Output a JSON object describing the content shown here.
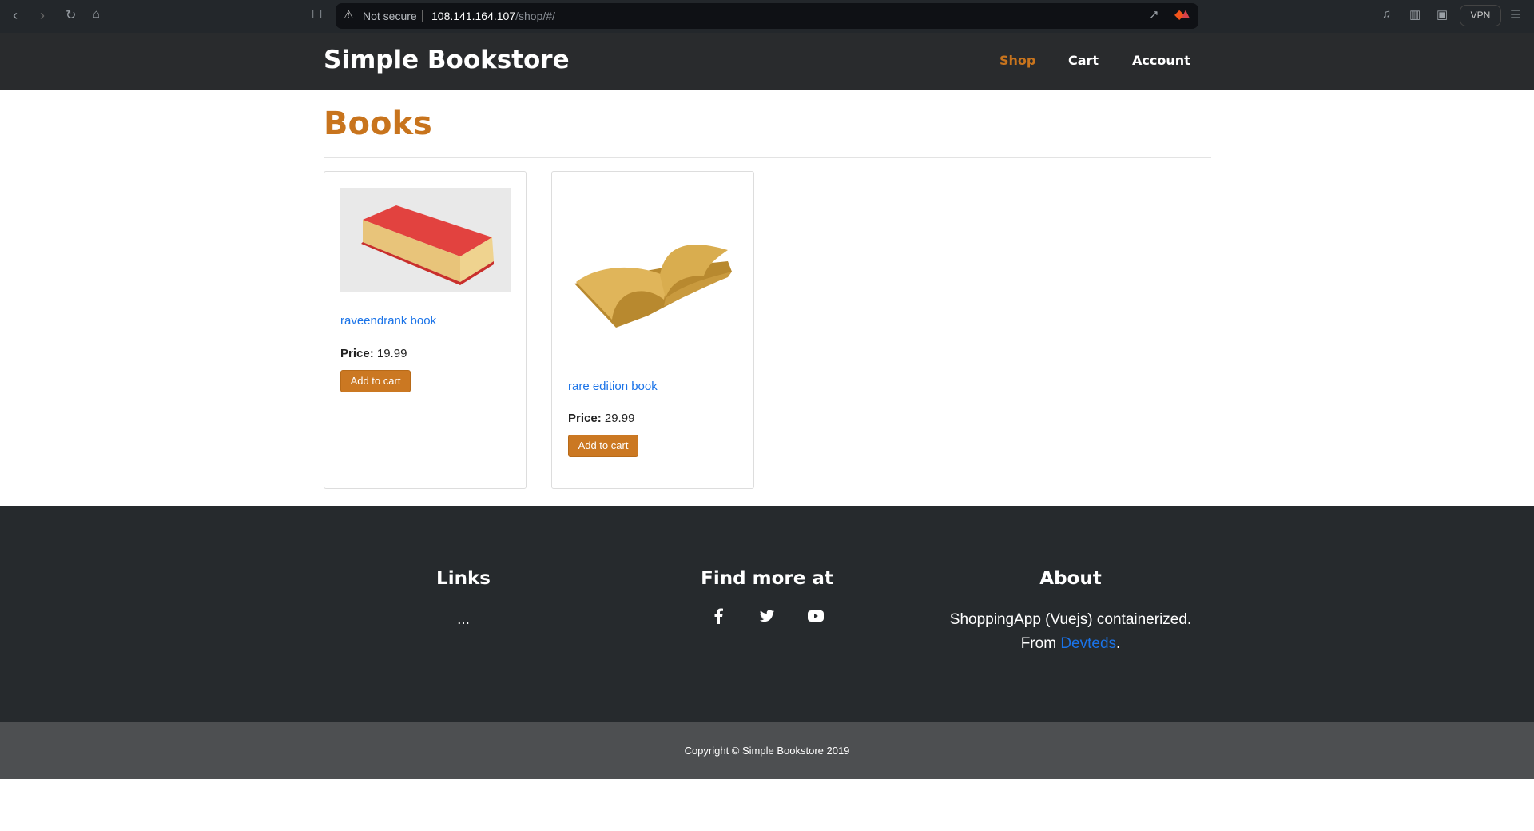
{
  "browser": {
    "security_label": "Not secure",
    "url_host": "108.141.164.107",
    "url_path": "/shop/#/",
    "vpn_label": "VPN"
  },
  "header": {
    "brand": "Simple Bookstore",
    "nav": [
      {
        "label": "Shop",
        "active": true
      },
      {
        "label": "Cart",
        "active": false
      },
      {
        "label": "Account",
        "active": false
      }
    ]
  },
  "main": {
    "title": "Books",
    "products": [
      {
        "name": "raveendrank book",
        "price_label": "Price:",
        "price": "19.99",
        "button": "Add to cart",
        "image": "red-book"
      },
      {
        "name": "rare edition book",
        "price_label": "Price:",
        "price": "29.99",
        "button": "Add to cart",
        "image": "open-golden-book"
      }
    ]
  },
  "footer": {
    "links": {
      "heading": "Links",
      "text": "..."
    },
    "find": {
      "heading": "Find more at",
      "icons": [
        "facebook-icon",
        "twitter-icon",
        "youtube-icon"
      ]
    },
    "about": {
      "heading": "About",
      "line1": "ShoppingApp (Vuejs) containerized.",
      "from": "From",
      "link": "Devteds",
      "period": "."
    },
    "copyright": "Copyright © Simple Bookstore 2019"
  },
  "colors": {
    "accent": "#c8741d",
    "link": "#1a73e8",
    "header_bg": "#292b2d",
    "footer_bg": "#262a2d",
    "copyright_bg": "#4d4f51"
  }
}
